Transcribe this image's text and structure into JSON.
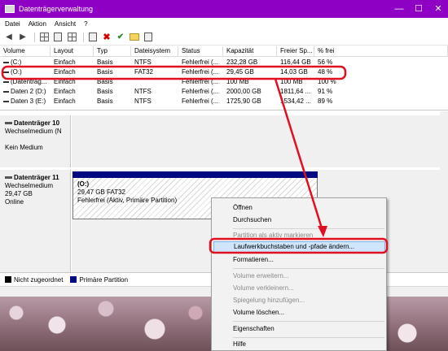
{
  "window": {
    "title": "Datenträgerverwaltung",
    "controls": [
      "—",
      "☐",
      "✕"
    ]
  },
  "menu": [
    "Datei",
    "Aktion",
    "Ansicht",
    "?"
  ],
  "volume_table": {
    "columns": [
      "Volume",
      "Layout",
      "Typ",
      "Dateisystem",
      "Status",
      "Kapazität",
      "Freier Sp...",
      "% frei"
    ],
    "rows": [
      [
        "(C:)",
        "Einfach",
        "Basis",
        "NTFS",
        "Fehlerfrei (...",
        "232,28 GB",
        "116,44 GB",
        "56 %"
      ],
      [
        "(O:)",
        "Einfach",
        "Basis",
        "FAT32",
        "Fehlerfrei (...",
        "29,45 GB",
        "14,03 GB",
        "48 %"
      ],
      [
        "(Datenträg...",
        "Einfach",
        "Basis",
        "",
        "Fehlerfrei (...",
        "100 MB",
        "100 MB",
        "100 %"
      ],
      [
        "Daten 2 (D:)",
        "Einfach",
        "Basis",
        "NTFS",
        "Fehlerfrei (...",
        "2000,00 GB",
        "1811,64 ...",
        "91 %"
      ],
      [
        "Daten 3 (E:)",
        "Einfach",
        "Basis",
        "NTFS",
        "Fehlerfrei (...",
        "1725,90 GB",
        "1534,42 ...",
        "89 %"
      ]
    ]
  },
  "disks": [
    {
      "name": "Datenträger 10",
      "type": "Wechselmedium (N",
      "extra": "",
      "status": "Kein Medium"
    },
    {
      "name": "Datenträger 11",
      "type": "Wechselmedium",
      "extra": "29,47 GB",
      "status": "Online"
    }
  ],
  "partition": {
    "name": "(O:)",
    "size": "29,47 GB FAT32",
    "status": "Fehlerfrei (Aktiv, Primäre Partition)"
  },
  "legend": [
    {
      "label": "Nicht zugeordnet",
      "color": "#000000"
    },
    {
      "label": "Primäre Partition",
      "color": "#000a80"
    }
  ],
  "context_menu": {
    "items": [
      {
        "label": "Öffnen",
        "enabled": true
      },
      {
        "label": "Durchsuchen",
        "enabled": true
      },
      {
        "label": "Partition als aktiv markieren",
        "enabled": false
      },
      {
        "label": "Laufwerkbuchstaben und -pfade ändern...",
        "enabled": true,
        "highlighted": true
      },
      {
        "label": "Formatieren...",
        "enabled": true
      },
      {
        "label": "Volume erweitern...",
        "enabled": false
      },
      {
        "label": "Volume verkleinern...",
        "enabled": false
      },
      {
        "label": "Spiegelung hinzufügen...",
        "enabled": false
      },
      {
        "label": "Volume löschen...",
        "enabled": true
      },
      {
        "label": "Eigenschaften",
        "enabled": true
      },
      {
        "label": "Hilfe",
        "enabled": true
      }
    ]
  },
  "colors": {
    "titlebar": "#8e00c4",
    "annotation": "#e01020",
    "primary_partition": "#000a80",
    "menu_highlight": "#cfe5fb"
  }
}
